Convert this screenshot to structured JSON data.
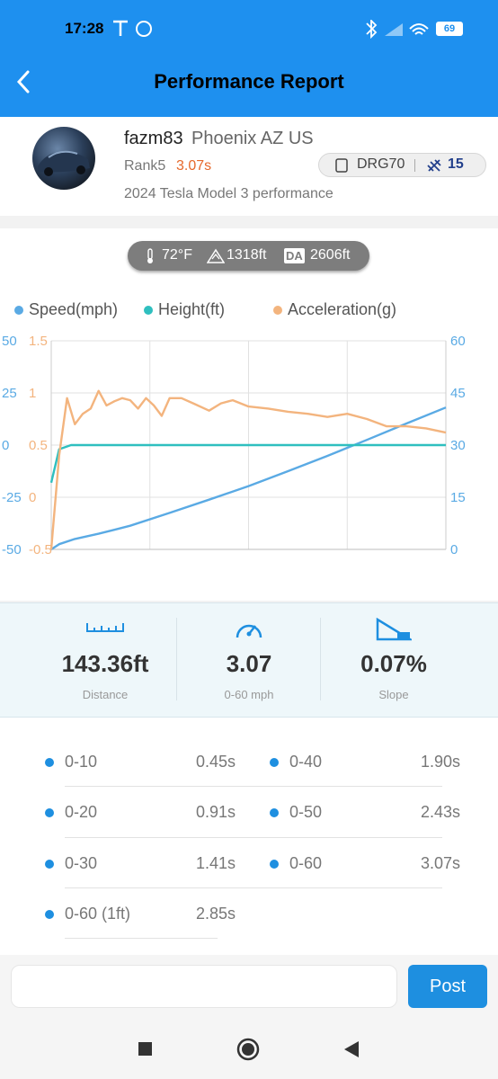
{
  "status": {
    "time": "17:28",
    "battery": "69"
  },
  "header": {
    "title": "Performance Report"
  },
  "profile": {
    "username": "fazm83",
    "location": "Phoenix AZ US",
    "rank": "Rank5",
    "rank_time": "3.07s",
    "car": "2024 Tesla Model 3 performance",
    "device": "DRG70",
    "satellites": "15"
  },
  "conditions": {
    "temp": "72°F",
    "altitude": "1318ft",
    "da_label": "DA",
    "density_altitude": "2606ft"
  },
  "colors": {
    "accent": "#1e8fe0",
    "speed": "#5aaae4",
    "height": "#2fbfbf",
    "accel": "#f3b47e",
    "rank_time": "#e6692c"
  },
  "chart_data": {
    "type": "line",
    "legend": [
      "Speed(mph)",
      "Height(ft)",
      "Acceleration(g)"
    ],
    "axes": {
      "left_outer": {
        "ticks": [
          "50",
          "25",
          "0",
          "-25",
          "-50"
        ],
        "range": [
          -50,
          50
        ]
      },
      "left_inner": {
        "ticks": [
          "1.5",
          "1",
          "0.5",
          "0",
          "-0.5"
        ],
        "range": [
          -0.5,
          1.5
        ]
      },
      "right": {
        "ticks": [
          "60",
          "45",
          "30",
          "15",
          "0"
        ],
        "range": [
          0,
          60
        ]
      }
    },
    "grid": true,
    "x_range": [
      0,
      100
    ],
    "series": [
      {
        "name": "Speed(mph)",
        "axis": "right",
        "x": [
          0,
          2,
          6,
          12,
          20,
          30,
          40,
          50,
          60,
          70,
          80,
          90,
          100
        ],
        "y": [
          0,
          1.5,
          3.0,
          4.5,
          6.8,
          10.5,
          14.3,
          18.2,
          22.5,
          26.9,
          31.5,
          36.2,
          40.8
        ]
      },
      {
        "name": "Height(ft)",
        "axis": "left_outer",
        "x": [
          0,
          2,
          5,
          100
        ],
        "y": [
          -18,
          -2,
          0,
          0
        ]
      },
      {
        "name": "Acceleration(g)",
        "axis": "left_inner",
        "x": [
          0,
          2,
          4,
          6,
          8,
          10,
          12,
          14,
          16,
          18,
          20,
          22,
          24,
          26,
          28,
          30,
          33,
          36,
          40,
          43,
          46,
          50,
          55,
          60,
          65,
          70,
          75,
          80,
          85,
          90,
          95,
          100
        ],
        "y": [
          -0.5,
          0.4,
          0.95,
          0.7,
          0.8,
          0.85,
          1.02,
          0.88,
          0.92,
          0.95,
          0.93,
          0.85,
          0.95,
          0.88,
          0.78,
          0.95,
          0.95,
          0.9,
          0.83,
          0.9,
          0.93,
          0.87,
          0.85,
          0.82,
          0.8,
          0.77,
          0.8,
          0.75,
          0.68,
          0.68,
          0.66,
          0.62
        ]
      }
    ]
  },
  "stats": [
    {
      "value": "143.36ft",
      "label": "Distance"
    },
    {
      "value": "3.07",
      "label": "0-60 mph"
    },
    {
      "value": "0.07%",
      "label": "Slope"
    }
  ],
  "splits": [
    {
      "label": "0-10",
      "time": "0.45s"
    },
    {
      "label": "0-40",
      "time": "1.90s"
    },
    {
      "label": "0-20",
      "time": "0.91s"
    },
    {
      "label": "0-50",
      "time": "2.43s"
    },
    {
      "label": "0-30",
      "time": "1.41s"
    },
    {
      "label": "0-60",
      "time": "3.07s"
    },
    {
      "label": "0-60 (1ft)",
      "time": "2.85s"
    }
  ],
  "comment": {
    "placeholder": "",
    "post_label": "Post"
  }
}
